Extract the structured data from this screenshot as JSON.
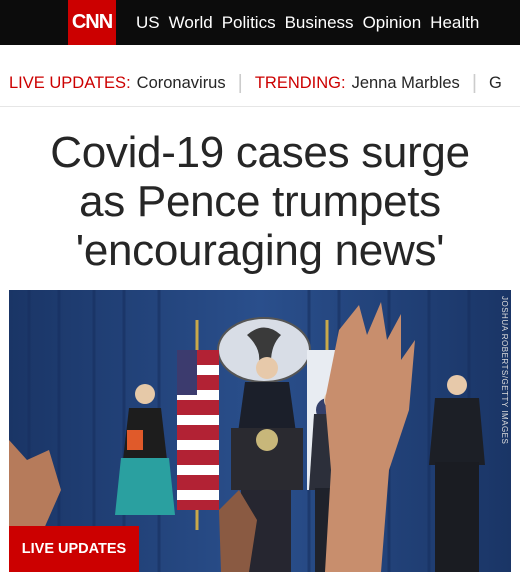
{
  "header": {
    "logo_text": "CNN",
    "nav_items": [
      "US",
      "World",
      "Politics",
      "Business",
      "Opinion",
      "Health"
    ]
  },
  "trending_bar": {
    "live_label": "LIVE UPDATES:",
    "live_value": "Coronavirus",
    "trending_label": "TRENDING:",
    "trending_value": "Jenna Marbles",
    "next_value": "G"
  },
  "article": {
    "headline_lines": [
      "Covid-19 cases surge",
      "as Pence trumpets",
      "'encouraging news'"
    ],
    "photo_credit": "JOSHUA ROBERTS/GETTY IMAGES",
    "badge": "LIVE UPDATES"
  },
  "colors": {
    "brand_red": "#cc0000",
    "topbar": "#0c0c0c",
    "text": "#262626"
  }
}
